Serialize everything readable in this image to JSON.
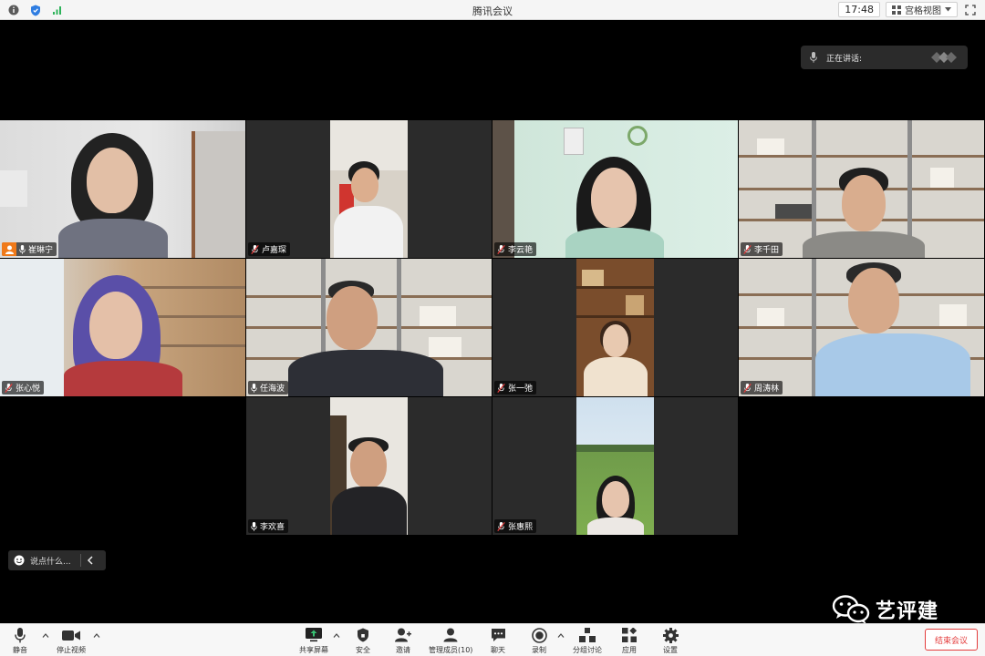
{
  "window": {
    "title": "腾讯会议",
    "time": "17:48",
    "view_mode": "宫格视图"
  },
  "speaking": {
    "label": "正在讲话:"
  },
  "participants": [
    {
      "name": "崔琳宁",
      "host": true
    },
    {
      "name": "卢嘉琛"
    },
    {
      "name": "李云艳"
    },
    {
      "name": "李千田"
    },
    {
      "name": "张心悦"
    },
    {
      "name": "任海波"
    },
    {
      "name": "张一弛"
    },
    {
      "name": "周涛林"
    },
    {
      "name": "李欢喜"
    },
    {
      "name": "张惠熙"
    }
  ],
  "chat": {
    "placeholder": "说点什么..."
  },
  "watermark": {
    "text": "艺评建"
  },
  "toolbar": {
    "mute": "静音",
    "stop_video": "停止视频",
    "share_screen": "共享屏幕",
    "security": "安全",
    "invite": "邀请",
    "manage_members": "管理成员(10)",
    "chat": "聊天",
    "record": "录制",
    "breakout": "分组讨论",
    "apps": "应用",
    "settings": "设置",
    "end_meeting": "结束会议"
  },
  "colors": {
    "accent_end": "#e43d3d",
    "host_badge": "#f07a1a"
  }
}
